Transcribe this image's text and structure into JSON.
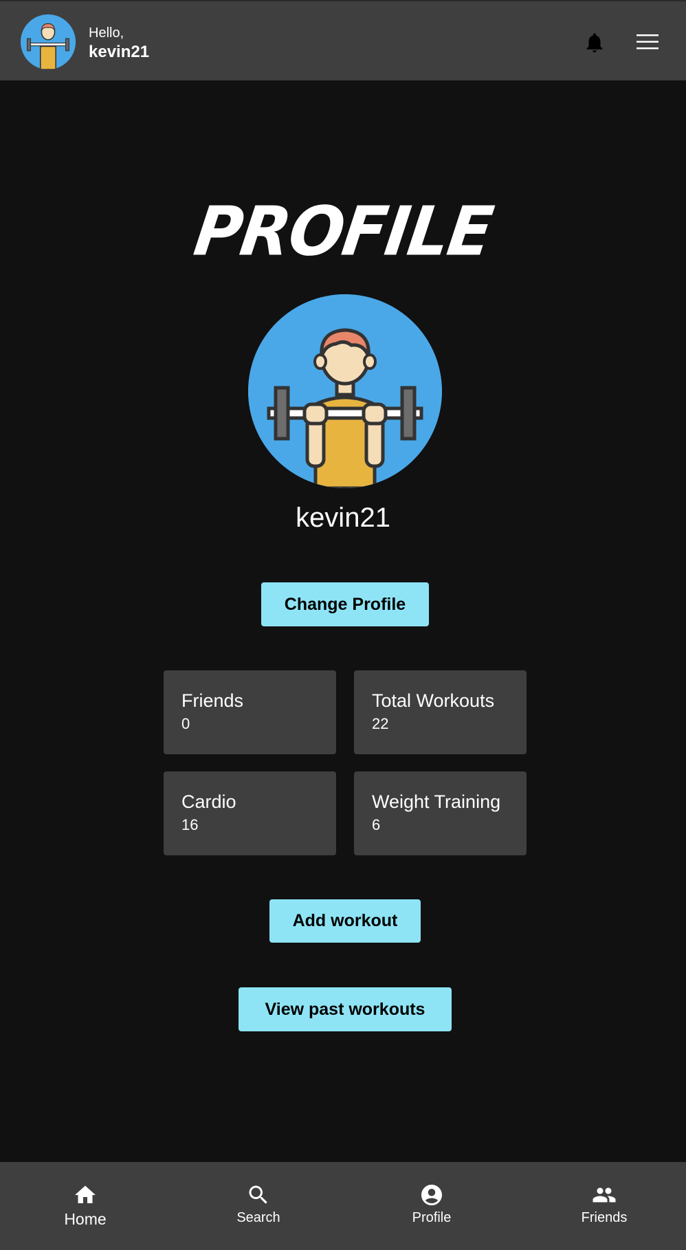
{
  "header": {
    "greeting": "Hello,",
    "username": "kevin21"
  },
  "page": {
    "title": "PROFILE",
    "username": "kevin21"
  },
  "buttons": {
    "change_profile": "Change Profile",
    "add_workout": "Add workout",
    "view_past": "View past workouts"
  },
  "stats": [
    {
      "label": "Friends",
      "value": "0"
    },
    {
      "label": "Total Workouts",
      "value": "22"
    },
    {
      "label": "Cardio",
      "value": "16"
    },
    {
      "label": "Weight Training",
      "value": "6"
    }
  ],
  "nav": [
    {
      "label": "Home",
      "icon": "home-icon"
    },
    {
      "label": "Search",
      "icon": "search-icon"
    },
    {
      "label": "Profile",
      "icon": "account-circle-icon"
    },
    {
      "label": "Friends",
      "icon": "people-icon"
    }
  ],
  "colors": {
    "background": "#111112",
    "surface": "#3f3f40",
    "accent": "#8ee4f5",
    "avatar_bg": "#4aa8e8"
  }
}
